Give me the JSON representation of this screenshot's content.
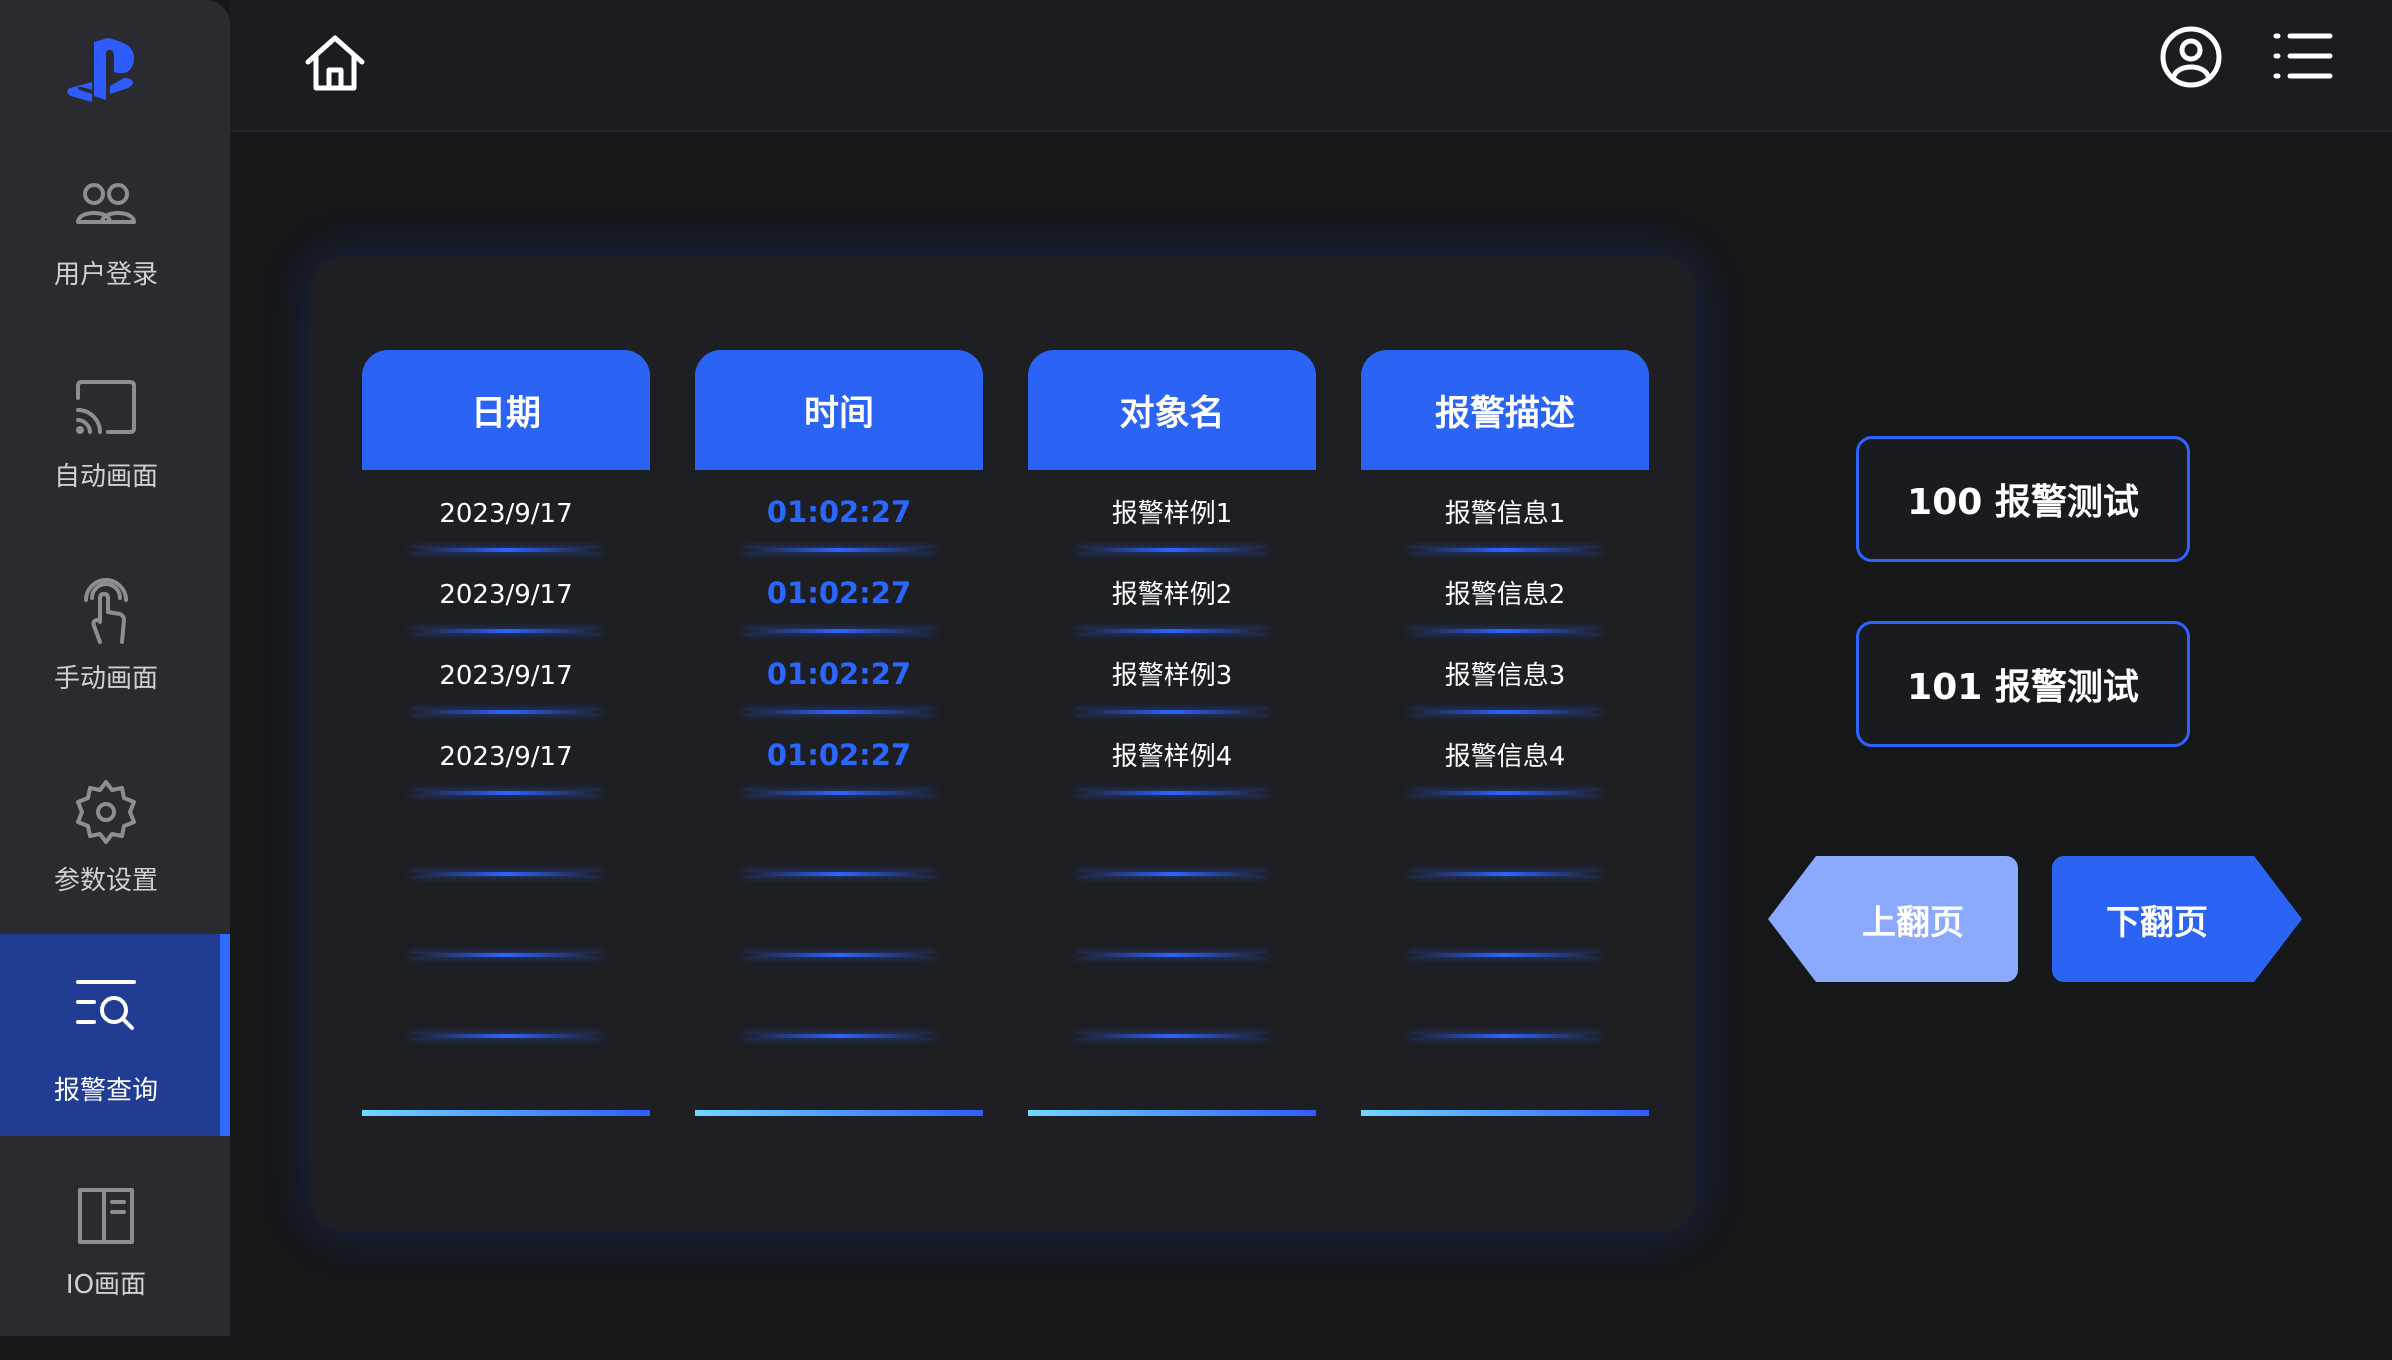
{
  "sidebar": {
    "items": [
      {
        "label": "用户登录",
        "icon": "users-icon"
      },
      {
        "label": "自动画面",
        "icon": "cast-icon"
      },
      {
        "label": "手动画面",
        "icon": "touch-icon"
      },
      {
        "label": "参数设置",
        "icon": "gear-icon"
      },
      {
        "label": "报警查询",
        "icon": "search-list-icon"
      },
      {
        "label": "IO画面",
        "icon": "panel-icon"
      }
    ],
    "active_index": 4
  },
  "table": {
    "headers": [
      "日期",
      "时间",
      "对象名",
      "报警描述"
    ],
    "rows": [
      [
        "2023/9/17",
        "01:02:27",
        "报警样例1",
        "报警信息1"
      ],
      [
        "2023/9/17",
        "01:02:27",
        "报警样例2",
        "报警信息2"
      ],
      [
        "2023/9/17",
        "01:02:27",
        "报警样例3",
        "报警信息3"
      ],
      [
        "2023/9/17",
        "01:02:27",
        "报警样例4",
        "报警信息4"
      ]
    ]
  },
  "actions": {
    "alarm1": "100 报警测试",
    "alarm2": "101 报警测试",
    "prev": "上翻页",
    "next": "下翻页"
  },
  "colors": {
    "accent": "#2b63f5",
    "accent_light": "#8aa9ff",
    "background": "#161719",
    "sidebar": "#2a2b30"
  }
}
